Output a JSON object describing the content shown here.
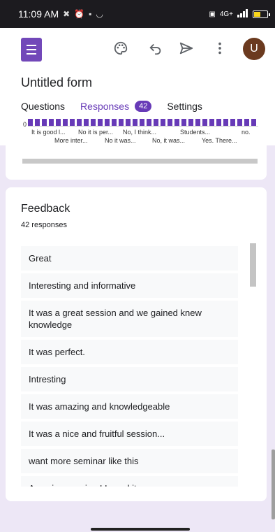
{
  "status_bar": {
    "time": "11:09 AM",
    "network": "4G+",
    "icons": [
      "silent-mode-icon",
      "alarm-icon",
      "sim-icon",
      "cloud-icon",
      "volte-icon",
      "signal-icon",
      "battery-icon"
    ]
  },
  "toolbar": {
    "logo": "google-forms-logo",
    "icons": [
      "palette-icon",
      "undo-icon",
      "send-icon",
      "more-vertical-icon"
    ],
    "avatar_letter": "U"
  },
  "form": {
    "title": "Untitled form",
    "tabs": [
      {
        "label": "Questions"
      },
      {
        "label": "Responses",
        "badge": "42",
        "active": true
      },
      {
        "label": "Settings"
      }
    ]
  },
  "previous_chart": {
    "zero_label": "0",
    "x_labels_row1": [
      "It is good l...",
      "No it is per...",
      "No, I think...",
      "Students...",
      "no."
    ],
    "x_labels_row2": [
      "More inter...",
      "No it was...",
      "No, it was...",
      "Yes. There..."
    ]
  },
  "question": {
    "title": "Feedback",
    "count": "42 responses",
    "responses": [
      "Great",
      "Interesting and informative",
      "It was a great session and we gained knew knowledge",
      "It was perfect.",
      "Intresting",
      "It was amazing and knowledgeable",
      "It was a nice and fruitful session...",
      "want more seminar like this",
      "Amazing session ! Loved it"
    ]
  },
  "colors": {
    "accent": "#673ab7",
    "background": "#ede7f6",
    "status_bar": "#1c1b1f",
    "avatar": "#6b3a1f"
  }
}
